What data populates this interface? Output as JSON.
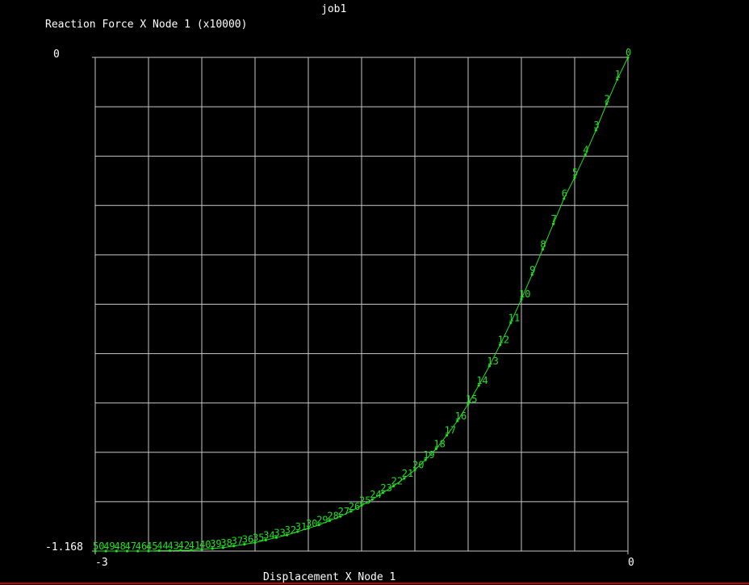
{
  "window": {
    "title": "job1"
  },
  "colors": {
    "background": "#000000",
    "grid": "#c8c8c8",
    "curve": "#20e020",
    "text": "#ffffff",
    "bottom_border": "#c00000"
  },
  "chart_data": {
    "type": "line",
    "title": "job1",
    "xlabel": "Displacement X Node 1",
    "ylabel": "Reaction Force X Node 1 (x10000)",
    "xlim": [
      -3,
      0
    ],
    "ylim": [
      -1.168,
      0
    ],
    "x_tick_labels": [
      "-3",
      "0"
    ],
    "y_tick_labels": [
      "-1.168",
      "0"
    ],
    "grid": true,
    "grid_divisions": {
      "x": 10,
      "y": 10
    },
    "series": [
      {
        "point_labels": [
          "0",
          "1",
          "2",
          "3",
          "4",
          "5",
          "6",
          "7",
          "8",
          "9",
          "10",
          "11",
          "12",
          "13",
          "14",
          "15",
          "16",
          "17",
          "18",
          "19",
          "20",
          "21",
          "22",
          "23",
          "24",
          "25",
          "26",
          "27",
          "28",
          "29",
          "30",
          "31",
          "32",
          "33",
          "34",
          "35",
          "36",
          "37",
          "38",
          "39",
          "40",
          "41",
          "42",
          "43",
          "44",
          "45",
          "46",
          "47",
          "48",
          "49",
          "50"
        ],
        "x": [
          0.0,
          -0.06,
          -0.12,
          -0.18,
          -0.24,
          -0.3,
          -0.36,
          -0.42,
          -0.48,
          -0.54,
          -0.6,
          -0.66,
          -0.72,
          -0.78,
          -0.84,
          -0.9,
          -0.96,
          -1.02,
          -1.08,
          -1.14,
          -1.2,
          -1.26,
          -1.32,
          -1.38,
          -1.44,
          -1.5,
          -1.56,
          -1.62,
          -1.68,
          -1.74,
          -1.8,
          -1.86,
          -1.92,
          -1.98,
          -2.04,
          -2.1,
          -2.16,
          -2.22,
          -2.28,
          -2.34,
          -2.4,
          -2.46,
          -2.52,
          -2.58,
          -2.64,
          -2.7,
          -2.76,
          -2.82,
          -2.88,
          -2.94,
          -3.0
        ],
        "y": [
          0.0,
          -0.052,
          -0.11,
          -0.172,
          -0.23,
          -0.284,
          -0.334,
          -0.394,
          -0.454,
          -0.514,
          -0.572,
          -0.628,
          -0.68,
          -0.73,
          -0.776,
          -0.82,
          -0.86,
          -0.894,
          -0.926,
          -0.952,
          -0.976,
          -0.996,
          -1.014,
          -1.03,
          -1.046,
          -1.06,
          -1.074,
          -1.086,
          -1.096,
          -1.106,
          -1.114,
          -1.122,
          -1.13,
          -1.136,
          -1.142,
          -1.148,
          -1.152,
          -1.156,
          -1.16,
          -1.162,
          -1.164,
          -1.166,
          -1.166,
          -1.167,
          -1.167,
          -1.168,
          -1.168,
          -1.168,
          -1.168,
          -1.168,
          -1.168
        ]
      }
    ]
  }
}
